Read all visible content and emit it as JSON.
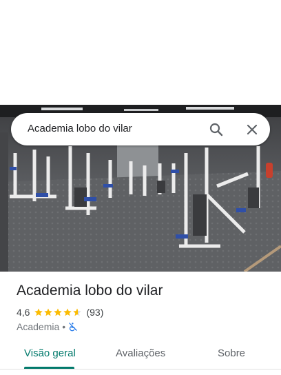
{
  "search": {
    "query": "Academia lobo do vilar"
  },
  "place": {
    "name": "Academia lobo do vilar",
    "rating": "4,6",
    "rating_value": 4.6,
    "reviews": "(93)",
    "category": "Academia",
    "separator": "•",
    "accessibility_icon": "wheelchair-not-accessible-icon"
  },
  "tabs": [
    {
      "label": "Visão geral",
      "active": true
    },
    {
      "label": "Avaliações",
      "active": false
    },
    {
      "label": "Sobre",
      "active": false
    }
  ],
  "colors": {
    "accent": "#00796b",
    "star": "#fbbc04",
    "access_icon": "#1a73e8"
  }
}
